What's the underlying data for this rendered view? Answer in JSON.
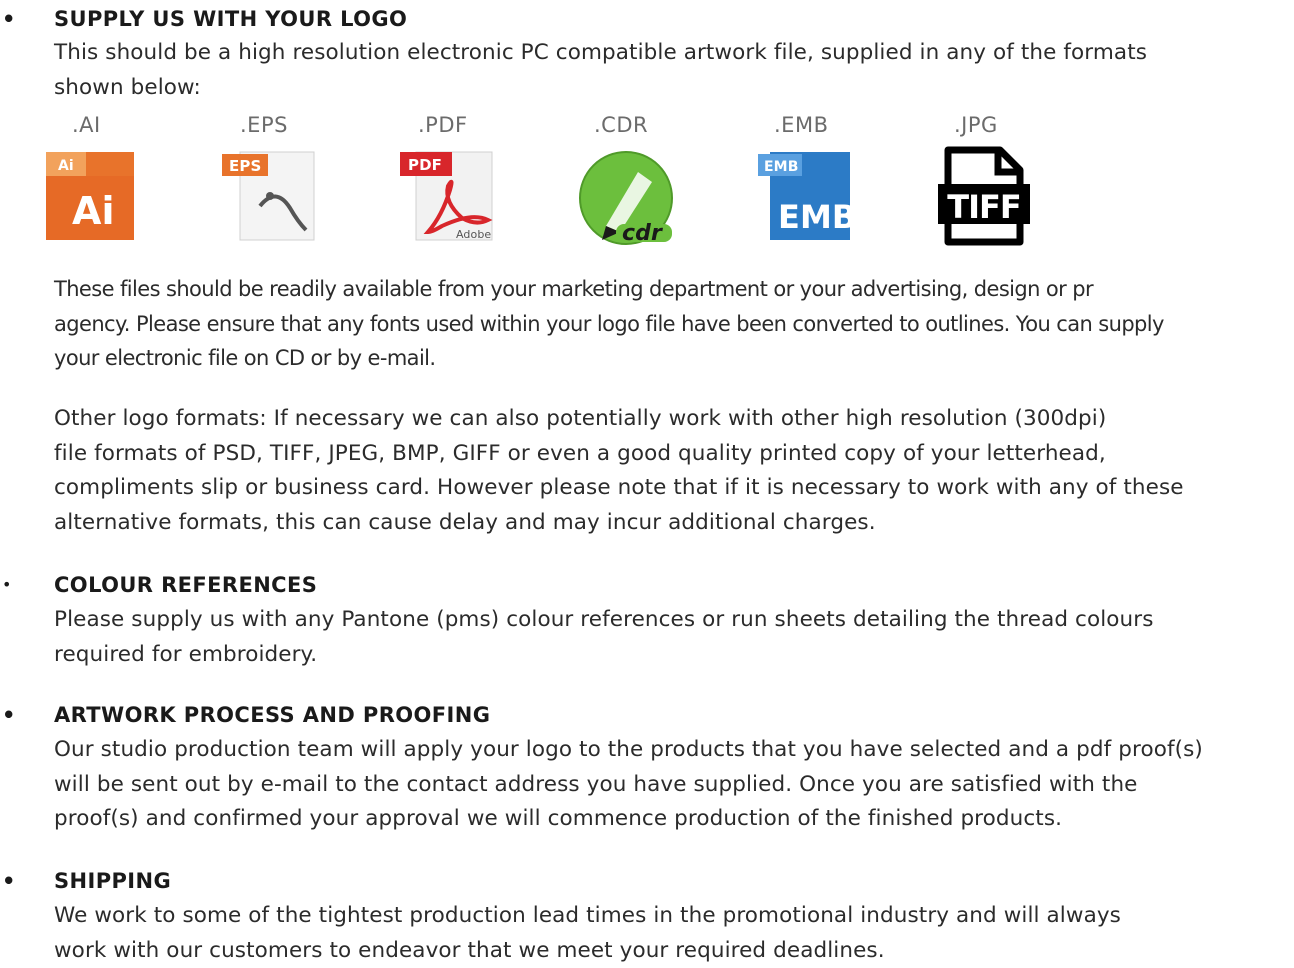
{
  "sections": {
    "logo": {
      "bullet": "•",
      "title": "SUPPLY US WITH YOUR LOGO",
      "intro_lines": [
        "This should be a high resolution electronic PC compatible artwork file, supplied in any of the formats",
        "shown below:"
      ],
      "formats": [
        {
          "label": ".AI",
          "icon": "illustrator-file-icon",
          "color": "#e8732b"
        },
        {
          "label": ".EPS",
          "icon": "eps-file-icon",
          "color": "#e8732b"
        },
        {
          "label": ".PDF",
          "icon": "pdf-file-icon",
          "color": "#d8262b"
        },
        {
          "label": ".CDR",
          "icon": "coreldraw-file-icon",
          "color": "#6cbf3d"
        },
        {
          "label": ".EMB",
          "icon": "emb-file-icon",
          "color": "#2c7bc6"
        },
        {
          "label": ".JPG",
          "icon": "tiff-file-icon",
          "color": "#000000"
        }
      ],
      "icon_texts": {
        "ai_tab": "Ai",
        "ai_main": "Ai",
        "eps_tab": "EPS",
        "pdf_tab": "PDF",
        "pdf_brand": "Adobe",
        "cdr_text": "cdr",
        "emb_tab": "EMB",
        "emb_main": "EMB",
        "tiff_text": "TIFF"
      },
      "files_lines": [
        "These files should be readily available from your marketing department or your advertising, design or pr",
        "agency. Please ensure that any fonts used within your logo file have been converted to outlines. You can supply",
        "your electronic file on CD or by e-mail."
      ],
      "other_lines": [
        "Other logo formats: If necessary we can also potentially work with other high resolution (300dpi)",
        "file formats of PSD, TIFF, JPEG, BMP, GIFF or even a good quality printed copy of your letterhead,",
        "compliments slip or business card. However please note that if it is necessary to work with any of these",
        "alternative formats, this can cause delay and may incur additional charges."
      ]
    },
    "colour": {
      "bullet": "•",
      "title": "COLOUR REFERENCES",
      "lines": [
        "Please supply us with any Pantone (pms) colour references or run sheets detailing the thread colours",
        "required for embroidery."
      ]
    },
    "artwork": {
      "bullet": "•",
      "title": "ARTWORK PROCESS AND PROOFING",
      "lines": [
        "Our studio production team will apply your logo to the products that you have selected and a pdf proof(s)",
        "will be sent out by e-mail to the contact address you have supplied. Once you are satisfied with the",
        "proof(s) and confirmed your approval we will commence production of the finished products."
      ]
    },
    "shipping": {
      "bullet": "•",
      "title": "SHIPPING",
      "lines": [
        "We work to some of the tightest production lead times in the promotional industry and will always",
        "work with our customers to endeavor that we meet your required deadlines."
      ]
    }
  }
}
